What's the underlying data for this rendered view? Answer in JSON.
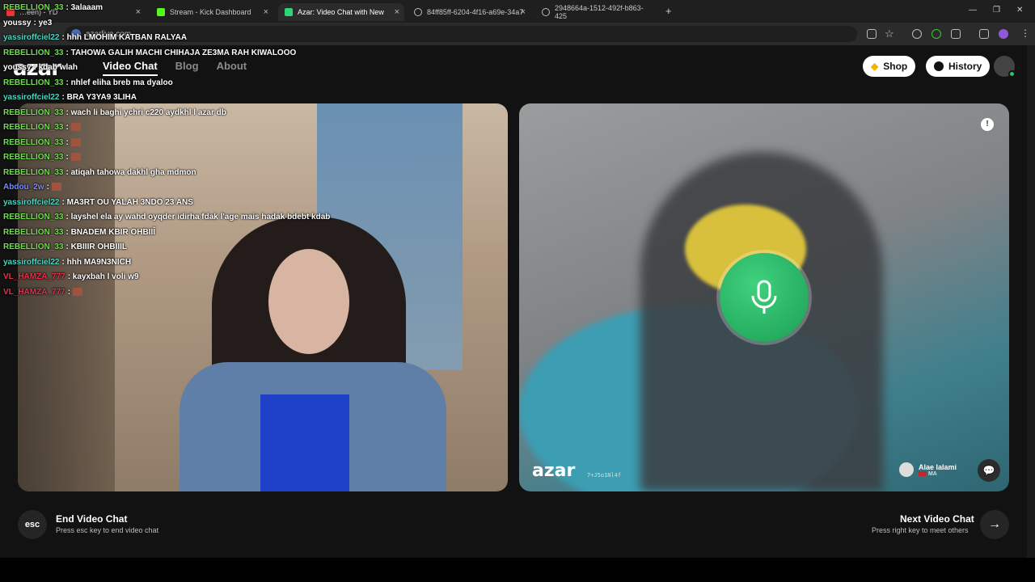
{
  "browser": {
    "tabs": [
      {
        "label": "…een) - YD",
        "active": false
      },
      {
        "label": "Stream - Kick Dashboard",
        "active": false
      },
      {
        "label": "Azar: Video Chat with New",
        "active": true
      },
      {
        "label": "84ff85ff-6204-4f16-a69e-34a7",
        "active": false
      },
      {
        "label": "2948664a-1512-492f-b863-425",
        "active": false
      }
    ],
    "url": "azarlive.com"
  },
  "app": {
    "logo": "azar",
    "nav": [
      "Video Chat",
      "Blog",
      "About"
    ],
    "shop_label": "Shop",
    "history_label": "History"
  },
  "right_video": {
    "watermark": "azar",
    "watermark_id": "7+J5o1Nl4f",
    "peer_name": "Alae lalami",
    "peer_country": "MA"
  },
  "footer": {
    "esc_key": "esc",
    "end_title": "End Video Chat",
    "end_sub": "Press esc key to end video chat",
    "next_title": "Next Video Chat",
    "next_sub": "Press right key to meet others"
  },
  "chat_overlay": [
    {
      "user": "REBELLION_33",
      "text": ": 3alaaam",
      "color": "#6ee04a"
    },
    {
      "user": "youssy",
      "text": ": ye3",
      "color": "#ffffff"
    },
    {
      "user": "yassiroffciel22",
      "text": ": hhh LMOHIM KATBAN RALYAA",
      "color": "#4fd6c0"
    },
    {
      "user": "REBELLION_33",
      "text": ": TAHOWA GALIH MACHI CHIHAJA ZE3MA RAH KIWALOOO",
      "color": "#6ee04a"
    },
    {
      "user": "youssy",
      "text": ": kdab wlah",
      "color": "#ffffff"
    },
    {
      "user": "REBELLION_33",
      "text": ": nhlef eliha breb ma dyaloo",
      "color": "#6ee04a"
    },
    {
      "user": "yassiroffciel22",
      "text": ": BRA Y3YA9 3LIHA",
      "color": "#4fd6c0"
    },
    {
      "user": "REBELLION_33",
      "text": ": wach li baghi ychri c220 aydkhl l azar db",
      "color": "#6ee04a"
    },
    {
      "user": "REBELLION_33",
      "text": ":",
      "color": "#6ee04a",
      "emote": true
    },
    {
      "user": "REBELLION_33",
      "text": ":",
      "color": "#6ee04a",
      "emote": true
    },
    {
      "user": "REBELLION_33",
      "text": ":",
      "color": "#6ee04a",
      "emote": true
    },
    {
      "user": "REBELLION_33",
      "text": ": atiqah tahowa dakhl gha mdmon",
      "color": "#6ee04a"
    },
    {
      "user": "Abdou_2w",
      "text": ":",
      "color": "#7a8cff",
      "emote": true
    },
    {
      "user": "yassiroffciel22",
      "text": ": MA3RT OU YALAH 3NDO 23 ANS",
      "color": "#4fd6c0"
    },
    {
      "user": "REBELLION_33",
      "text": ": layshel ela ay wahd oyqder idirha fdak l'age mais hadak bdebt kdab",
      "color": "#6ee04a"
    },
    {
      "user": "REBELLION_33",
      "text": ": BNADEM KBIR OHBIIÎ",
      "color": "#6ee04a"
    },
    {
      "user": "REBELLION_33",
      "text": ": KBIIIR OHBIIIL",
      "color": "#6ee04a"
    },
    {
      "user": "yassiroffciel22",
      "text": ": hhh MA9N3NICH",
      "color": "#4fd6c0"
    },
    {
      "user": "VL_HAMZA_777",
      "text": ": kayxbah l voli w9",
      "color": "#e2334b"
    },
    {
      "user": "VL_HAMZA_777",
      "text": ":",
      "color": "#e2334b",
      "emote": true
    }
  ]
}
